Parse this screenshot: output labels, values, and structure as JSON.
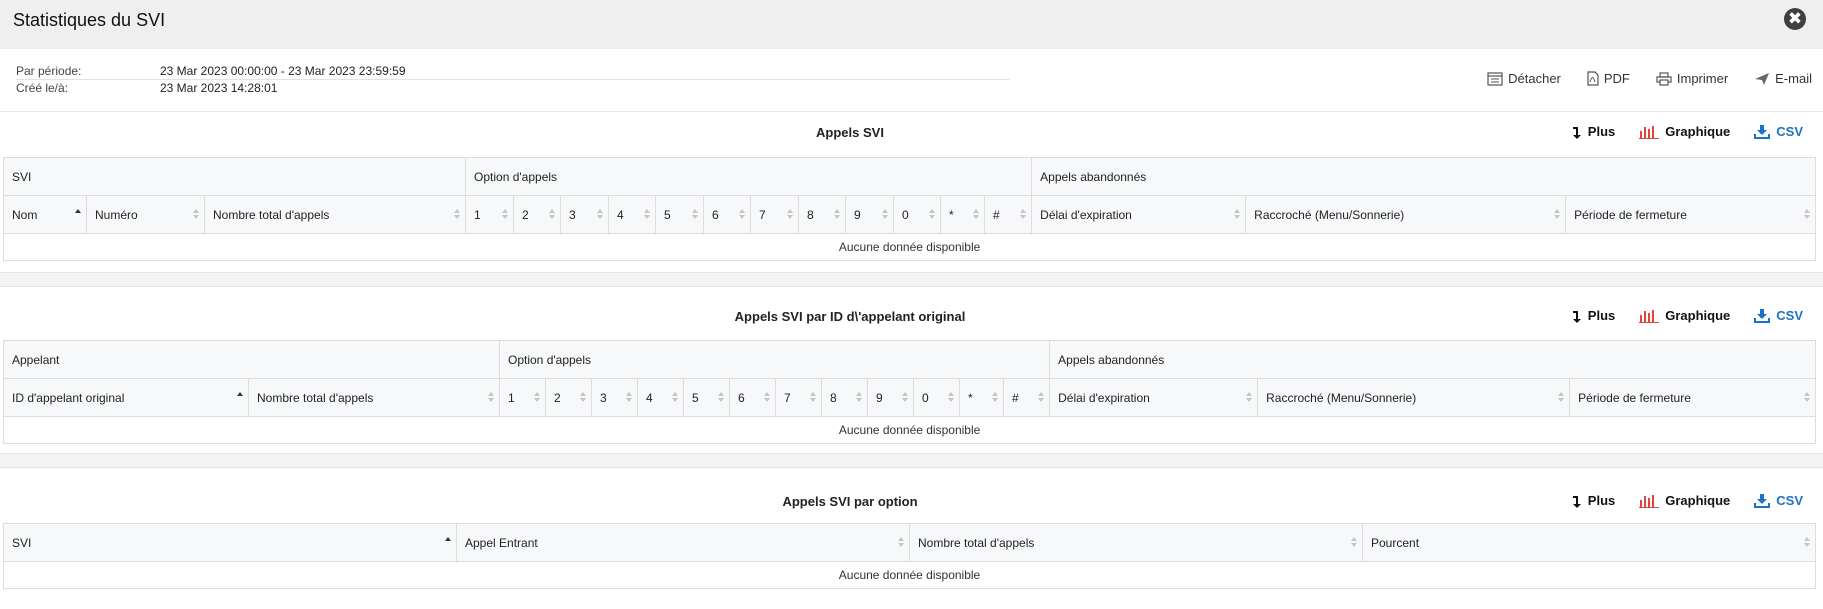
{
  "window": {
    "title": "Statistiques du SVI",
    "close_label": "✖"
  },
  "meta": {
    "period_label": "Par période:",
    "period_value": "23 Mar 2023 00:00:00 - 23 Mar 2023 23:59:59",
    "created_label": "Créé le/à:",
    "created_value": "23 Mar 2023 14:28:01"
  },
  "actions": {
    "detach": "Détacher",
    "pdf": "PDF",
    "print": "Imprimer",
    "email": "E-mail"
  },
  "tools": {
    "more": "Plus",
    "chart": "Graphique",
    "csv": "CSV"
  },
  "sections": [
    {
      "title": "Appels SVI",
      "groups": [
        "SVI",
        "Option d'appels",
        "Appels abandonnés"
      ],
      "columns": [
        "Nom",
        "Numéro",
        "Nombre total d'appels",
        "1",
        "2",
        "3",
        "4",
        "5",
        "6",
        "7",
        "8",
        "9",
        "0",
        "*",
        "#",
        "Délai d'expiration",
        "Raccroché (Menu/Sonnerie)",
        "Période de fermeture"
      ],
      "empty": "Aucune donnée disponible"
    },
    {
      "title": "Appels SVI par ID d\\'appelant original",
      "groups": [
        "Appelant",
        "Option d'appels",
        "Appels abandonnés"
      ],
      "columns": [
        "ID d'appelant original",
        "Nombre total d'appels",
        "1",
        "2",
        "3",
        "4",
        "5",
        "6",
        "7",
        "8",
        "9",
        "0",
        "*",
        "#",
        "Délai d'expiration",
        "Raccroché (Menu/Sonnerie)",
        "Période de fermeture"
      ],
      "empty": "Aucune donnée disponible"
    },
    {
      "title": "Appels SVI par option",
      "columns": [
        "SVI",
        "Appel Entrant",
        "Nombre total d'appels",
        "Pourcent"
      ],
      "empty": "Aucune donnée disponible"
    }
  ],
  "colors": {
    "accent_blue": "#1b72c8",
    "chart_red": "#e0443a"
  }
}
